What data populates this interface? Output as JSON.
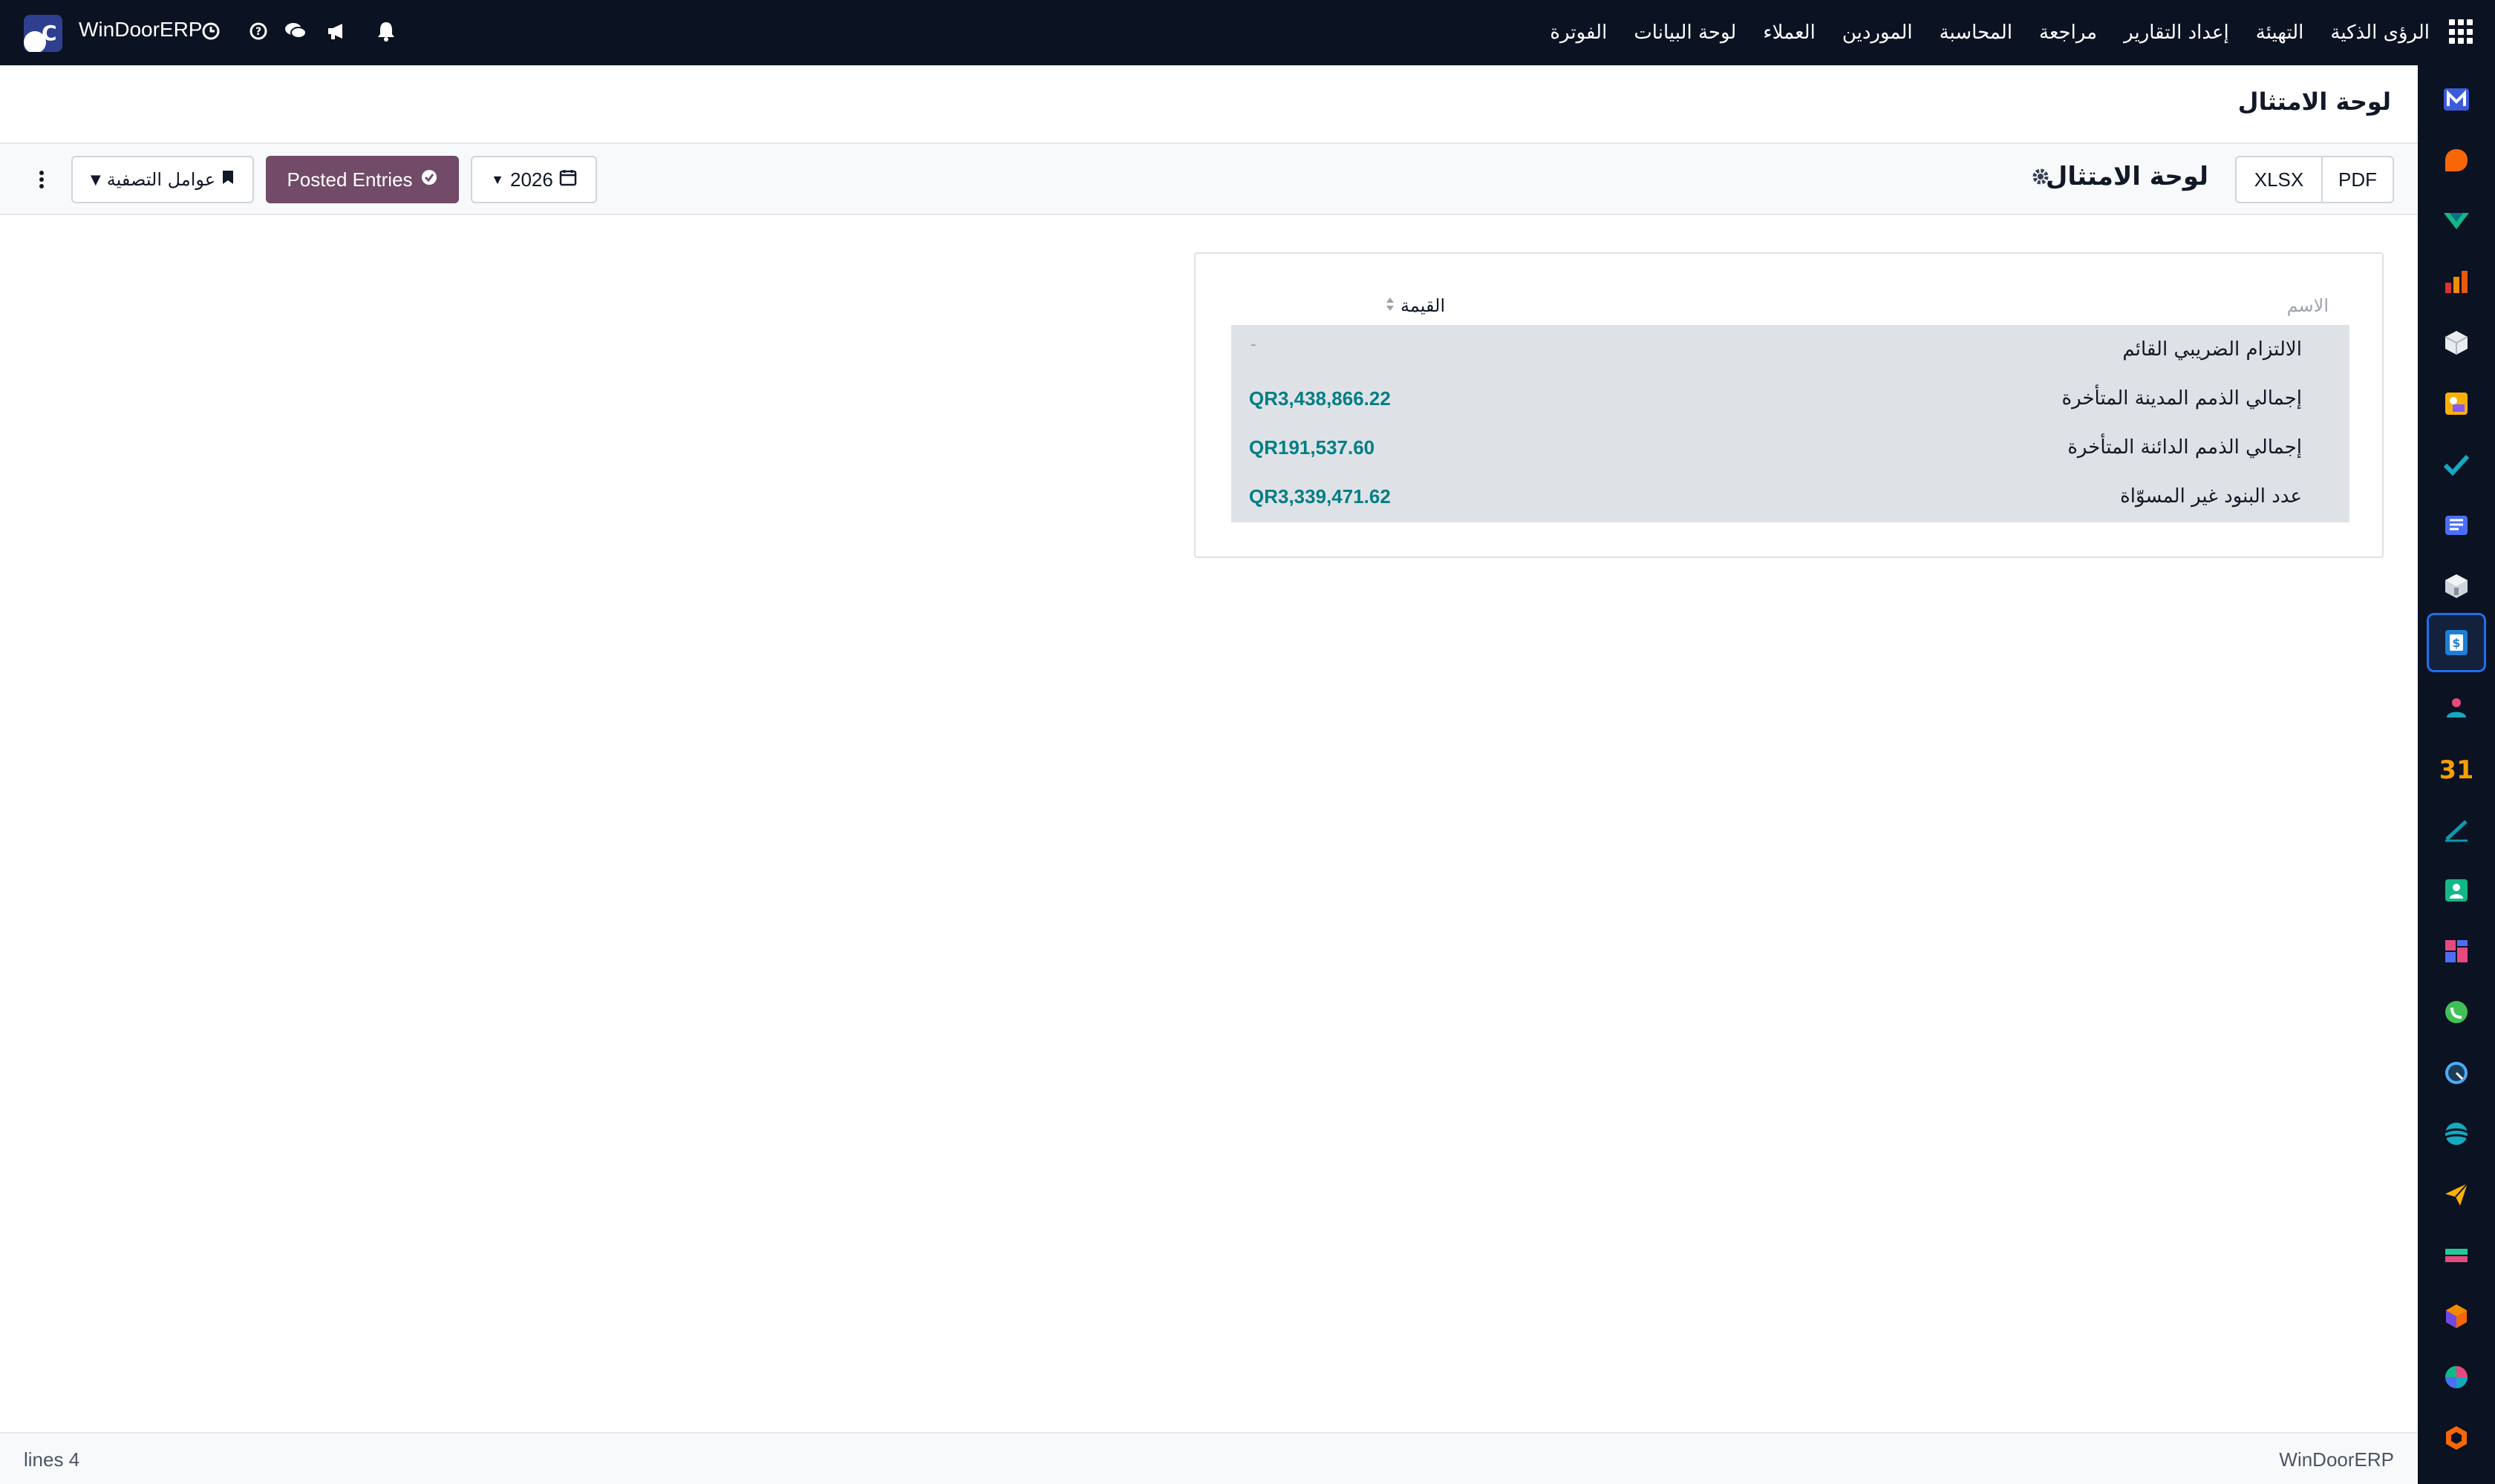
{
  "navbar": {
    "brand_letter": "C",
    "brand_name": "WinDoorERP",
    "menu": [
      "الفوترة",
      "لوحة البيانات",
      "العملاء",
      "الموردين",
      "المحاسبة",
      "مراجعة",
      "إعداد التقارير",
      "التهيئة",
      "الرؤى الذكية"
    ],
    "icons": [
      "clock-icon",
      "help-icon",
      "chat-icon",
      "megaphone-icon",
      "bell-icon",
      "apps-grid-icon"
    ]
  },
  "breadcrumb": {
    "title": "لوحة الامتثال"
  },
  "control_panel": {
    "report_title": "لوحة الامتثال",
    "pdf_label": "PDF",
    "xlsx_label": "XLSX",
    "year_label": "2026",
    "posted_label": "Posted Entries",
    "filters_label": "عوامل التصفية"
  },
  "report": {
    "columns": {
      "name": "الاسم",
      "value": "القيمة"
    },
    "rows": [
      {
        "name": "الالتزام الضريبي القائم",
        "value": ""
      },
      {
        "name": "إجمالي الذمم المدينة المتأخرة",
        "value": "QR3,438,866.22"
      },
      {
        "name": "إجمالي الذمم الدائنة المتأخرة",
        "value": "QR191,537.60"
      },
      {
        "name": "عدد البنود غير المسوّاة",
        "value": "QR3,339,471.62"
      }
    ],
    "empty_placeholder": "-",
    "value_color": "#017e84"
  },
  "footer": {
    "lines_count": "lines 4",
    "brand": "WinDoorERP"
  },
  "colors": {
    "navbar_bg": "#0b1222",
    "primary": "#714b67",
    "row_bg": "#dee2e6"
  },
  "sidebar_apps": [
    "mail-app-icon",
    "discuss-app-icon",
    "project-app-icon",
    "reports-app-icon",
    "inventory-app-icon",
    "gallery-app-icon",
    "tasks-app-icon",
    "knowledge-app-icon",
    "box-app-icon",
    "accounting-app-icon",
    "contacts-app-icon",
    "calendar-app-icon",
    "sign-app-icon",
    "employees-app-icon",
    "dashboards-app-icon",
    "whatsapp-app-icon",
    "clock-app-icon",
    "website-app-icon",
    "email-marketing-app-icon",
    "payments-app-icon",
    "cube-app-icon",
    "pie-app-icon",
    "hexagon-app-icon"
  ]
}
